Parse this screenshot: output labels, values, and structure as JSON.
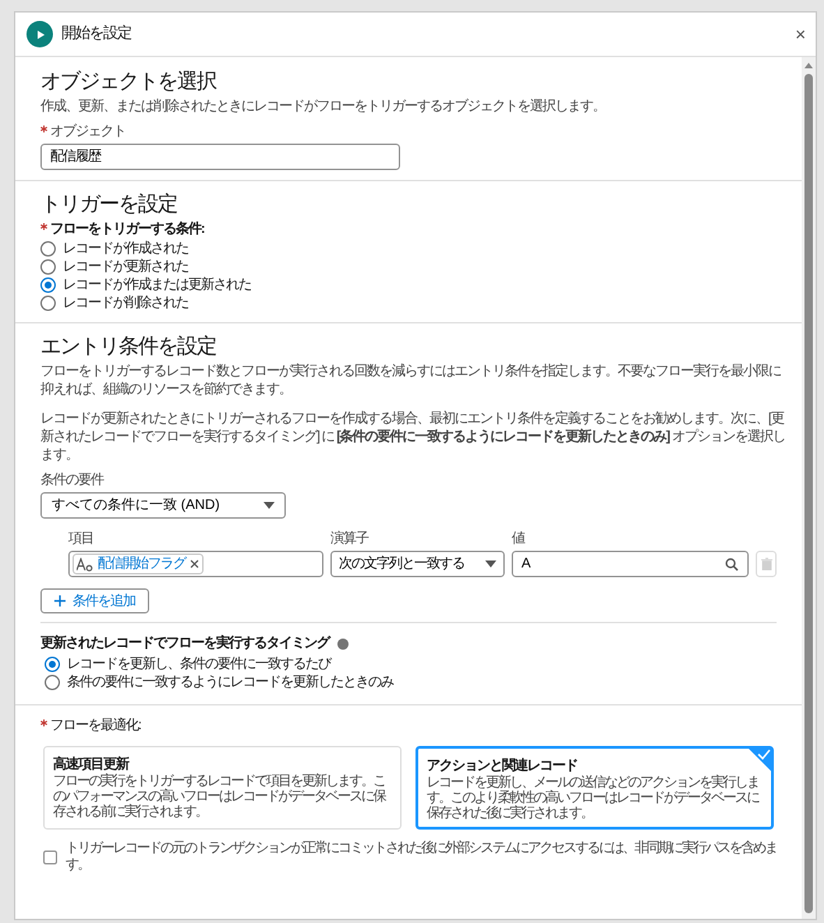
{
  "header": {
    "title": "開始を設定",
    "close": "×"
  },
  "object_section": {
    "heading": "オブジェクトを選択",
    "description": "作成、更新、または削除されたときにレコードがフローをトリガーするオブジェクトを選択します。",
    "field": {
      "label": "オブジェクト",
      "required": true,
      "value": "配信履歴"
    }
  },
  "trigger_section": {
    "heading": "トリガーを設定",
    "label": "フローをトリガーする条件:",
    "required": true,
    "options": [
      {
        "label": "レコードが作成された",
        "selected": false
      },
      {
        "label": "レコードが更新された",
        "selected": false
      },
      {
        "label": "レコードが作成または更新された",
        "selected": true
      },
      {
        "label": "レコードが削除された",
        "selected": false
      }
    ]
  },
  "entry_section": {
    "heading": "エントリ条件を設定",
    "paragraphs": [
      "フローをトリガーするレコード数とフローが実行される回数を減らすにはエントリ条件を指定します。不要なフロー実行を最小限に抑えれば、組織のリソースを節約できます。",
      "レコードが更新されたときにトリガーされるフローを作成する場合、最初にエントリ条件を定義することをお勧めします。次に、[更新されたレコードでフローを実行するタイミング] に **[条件の要件に一致するようにレコードを更新したときのみ]** オプションを選択します。"
    ],
    "requirement": {
      "label": "条件の要件",
      "value": "すべての条件に一致 (AND)"
    },
    "condition": {
      "field_label": "項目",
      "field_value": "配信開始フラグ",
      "operator_label": "演算子",
      "operator_value": "次の文字列と一致する",
      "value_label": "値",
      "value": "A"
    },
    "add_button": "条件を追加"
  },
  "timing_section": {
    "label": "更新されたレコードでフローを実行するタイミング",
    "options": [
      {
        "label": "レコードを更新し、条件の要件に一致するたび",
        "selected": true
      },
      {
        "label": "条件の要件に一致するようにレコードを更新したときのみ",
        "selected": false
      }
    ]
  },
  "optimize_section": {
    "label": "フローを最適化:",
    "required": true,
    "cards": [
      {
        "title": "高速項目更新",
        "description": "フローの実行をトリガーするレコードで項目を更新します。このパフォーマンスの高いフローはレコードがデータベースに保存される前に実行されます。",
        "selected": false
      },
      {
        "title": "アクションと関連レコード",
        "description": "レコードを更新し、メールの送信などのアクションを実行します。このより柔軟性の高いフローはレコードがデータベースに保存された後に実行されます。",
        "selected": true
      }
    ],
    "checkbox": {
      "label": "トリガーレコードの元のトランザクションが正常にコミットされた後に外部システムにアクセスするには、非同期に実行パスを含めます。",
      "checked": false
    }
  }
}
